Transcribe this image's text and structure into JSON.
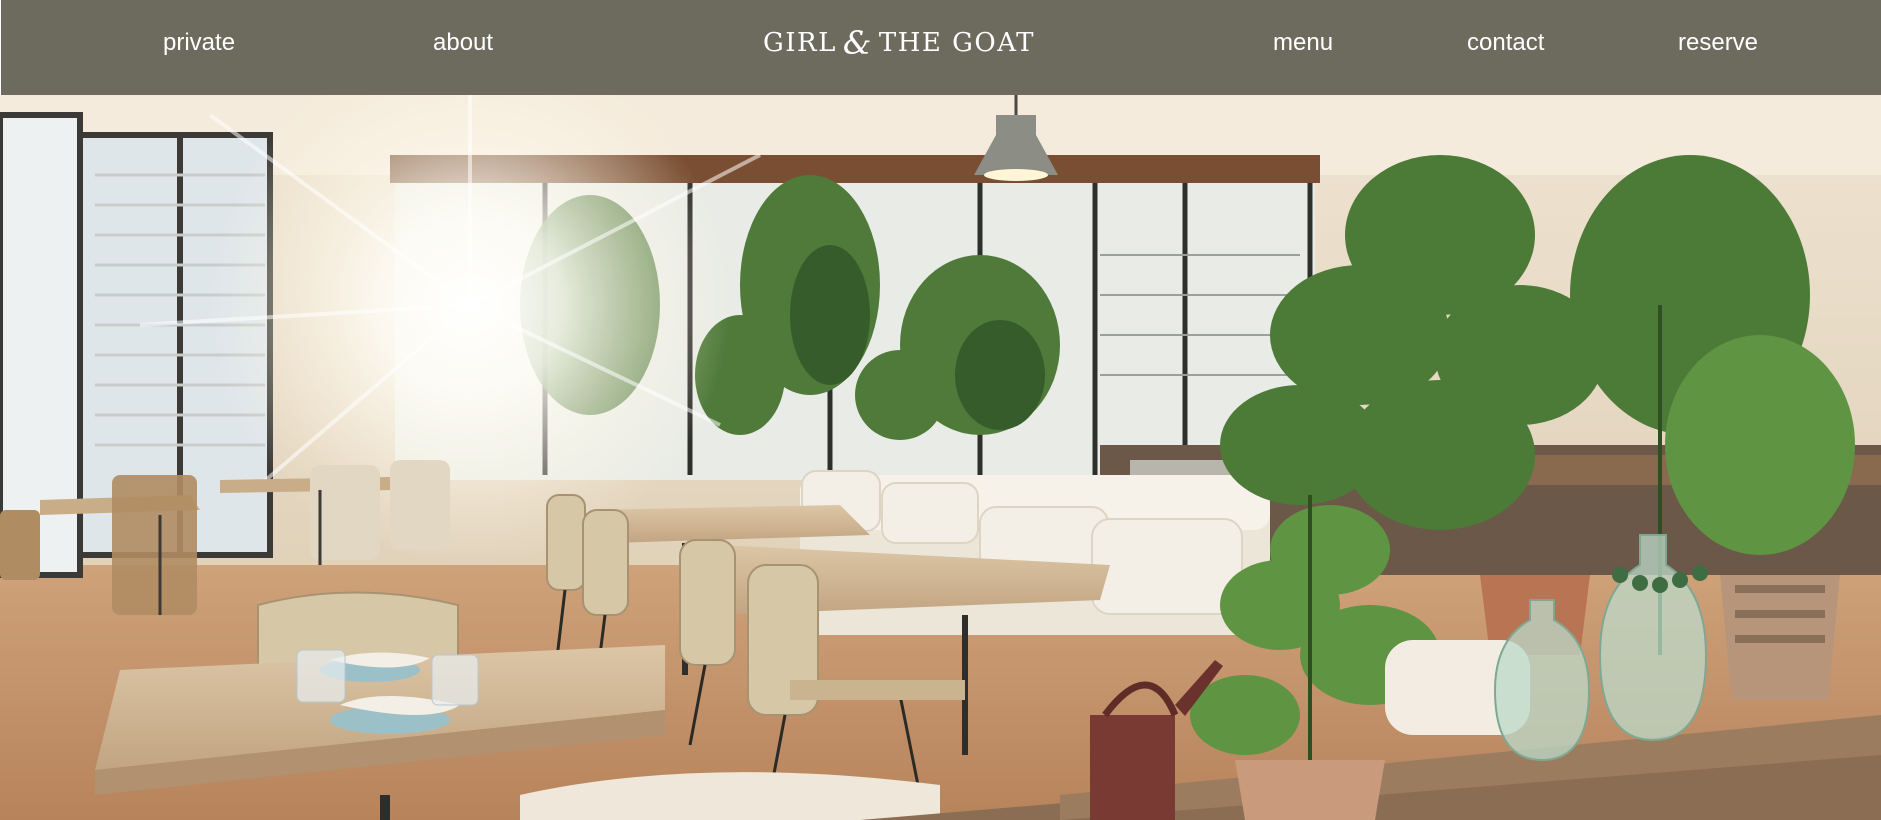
{
  "nav": {
    "private": "private",
    "about": "about",
    "menu": "menu",
    "contact": "contact",
    "reserve": "reserve"
  },
  "brand": {
    "left": "GIRL",
    "amp": "&",
    "right": "THE GOAT"
  },
  "colors": {
    "nav_background": "#6d6b5e",
    "nav_text": "#ffffff"
  },
  "hero": {
    "description_icon": "restaurant-interior-photo"
  }
}
